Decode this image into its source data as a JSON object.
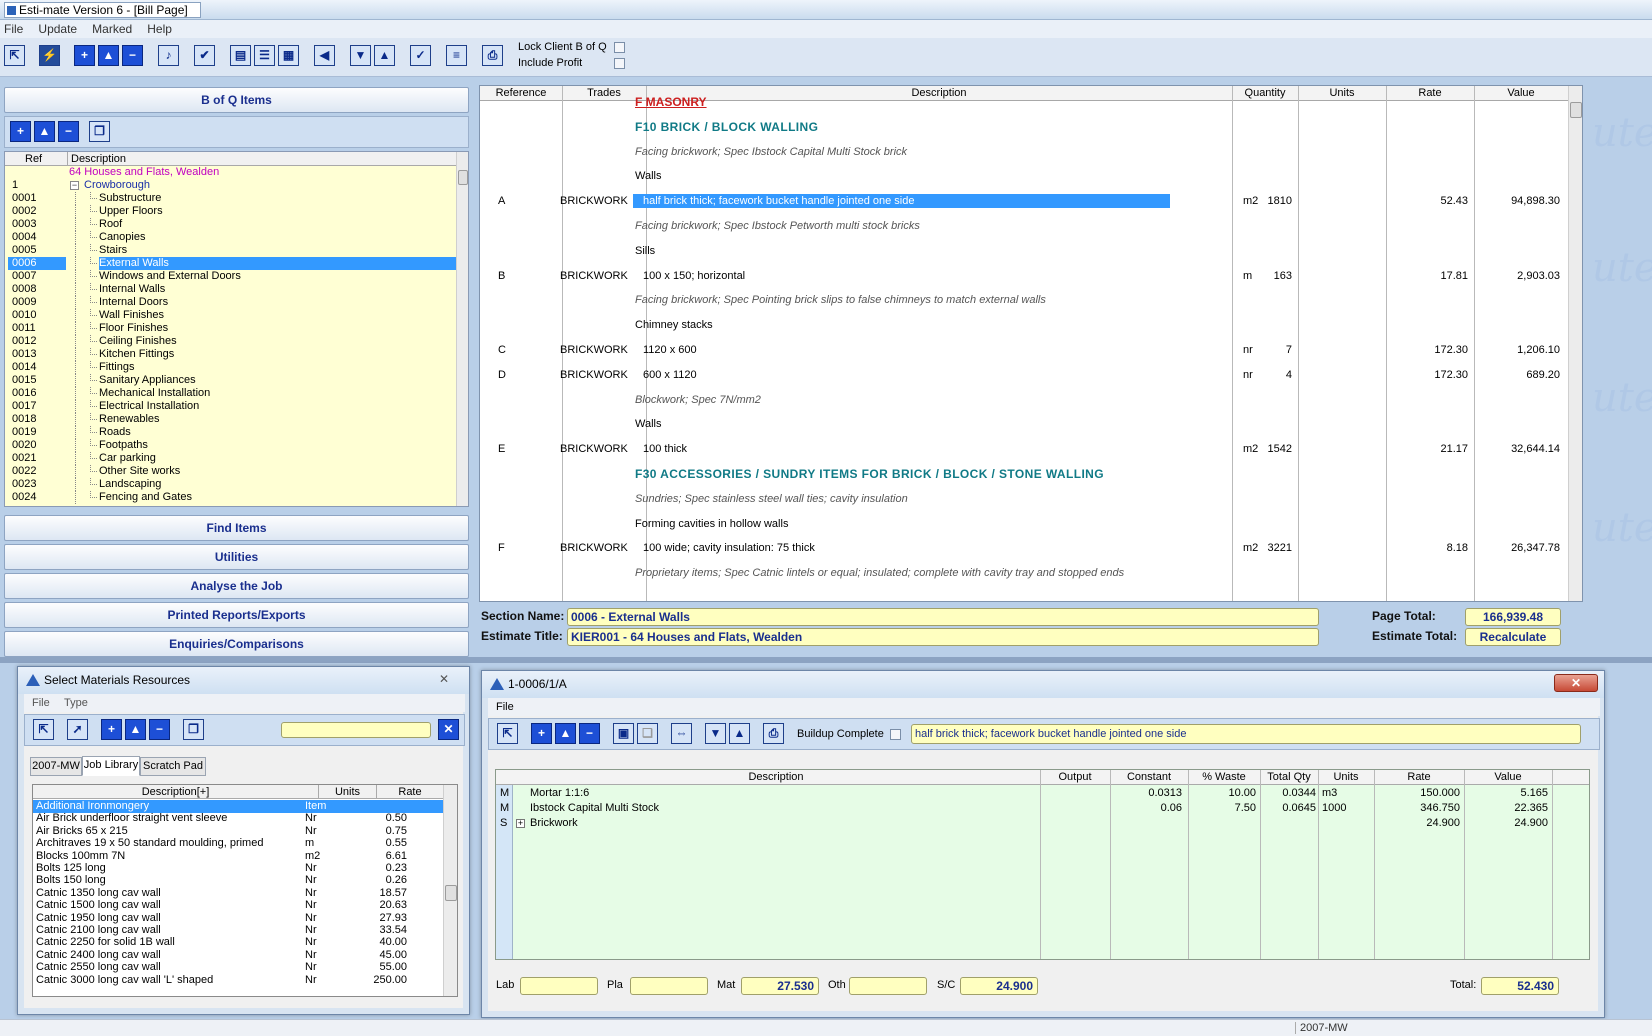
{
  "window": {
    "title": "Esti-mate Version 6 - [Bill Page]"
  },
  "menu": [
    "File",
    "Update",
    "Marked",
    "Help"
  ],
  "toolbar": {
    "lock_client_label": "Lock Client B of Q",
    "include_profit_label": "Include Profit"
  },
  "left_panel": {
    "boq_button": "B of Q Items",
    "tree_headers": {
      "ref": "Ref",
      "description": "Description"
    },
    "tree_rows": [
      {
        "ref": "",
        "desc": "64 Houses and Flats, Wealden",
        "level": 0,
        "color": "#c000c0"
      },
      {
        "ref": "1",
        "desc": "Crowborough",
        "level": 1,
        "color": "#1a2fa8"
      },
      {
        "ref": "0001",
        "desc": "Substructure",
        "level": 2
      },
      {
        "ref": "0002",
        "desc": "Upper Floors",
        "level": 2
      },
      {
        "ref": "0003",
        "desc": "Roof",
        "level": 2
      },
      {
        "ref": "0004",
        "desc": "Canopies",
        "level": 2
      },
      {
        "ref": "0005",
        "desc": "Stairs",
        "level": 2
      },
      {
        "ref": "0006",
        "desc": "External Walls",
        "level": 2,
        "selected": true
      },
      {
        "ref": "0007",
        "desc": "Windows and External Doors",
        "level": 2
      },
      {
        "ref": "0008",
        "desc": "Internal Walls",
        "level": 2
      },
      {
        "ref": "0009",
        "desc": "Internal Doors",
        "level": 2
      },
      {
        "ref": "0010",
        "desc": "Wall Finishes",
        "level": 2
      },
      {
        "ref": "0011",
        "desc": "Floor Finishes",
        "level": 2
      },
      {
        "ref": "0012",
        "desc": "Ceiling Finishes",
        "level": 2
      },
      {
        "ref": "0013",
        "desc": "Kitchen Fittings",
        "level": 2
      },
      {
        "ref": "0014",
        "desc": "Fittings",
        "level": 2
      },
      {
        "ref": "0015",
        "desc": "Sanitary Appliances",
        "level": 2
      },
      {
        "ref": "0016",
        "desc": "Mechanical Installation",
        "level": 2
      },
      {
        "ref": "0017",
        "desc": "Electrical Installation",
        "level": 2
      },
      {
        "ref": "0018",
        "desc": "Renewables",
        "level": 2
      },
      {
        "ref": "0019",
        "desc": "Roads",
        "level": 2
      },
      {
        "ref": "0020",
        "desc": "Footpaths",
        "level": 2
      },
      {
        "ref": "0021",
        "desc": "Car parking",
        "level": 2
      },
      {
        "ref": "0022",
        "desc": "Other Site works",
        "level": 2
      },
      {
        "ref": "0023",
        "desc": "Landscaping",
        "level": 2
      },
      {
        "ref": "0024",
        "desc": "Fencing and Gates",
        "level": 2
      }
    ],
    "buttons": [
      "Find Items",
      "Utilities",
      "Analyse the Job",
      "Printed Reports/Exports",
      "Enquiries/Comparisons"
    ]
  },
  "bill_grid": {
    "headers": [
      "Reference",
      "Trades",
      "Description",
      "Quantity",
      "Units",
      "Rate",
      "Value"
    ],
    "rows": [
      {
        "type": "h-red",
        "desc": "F MASONRY"
      },
      {
        "type": "h-teal",
        "desc": "F10 BRICK / BLOCK WALLING"
      },
      {
        "type": "ital",
        "desc": "Facing brickwork; Spec Ibstock Capital Multi Stock brick"
      },
      {
        "type": "plain",
        "desc": "Walls"
      },
      {
        "type": "item",
        "ref": "A",
        "trade": "BRICKWORK",
        "desc": "half brick thick; facework bucket handle jointed one side",
        "qty": "1810",
        "units": "m2",
        "rate": "52.43",
        "value": "94,898.30",
        "selected": true
      },
      {
        "type": "ital",
        "desc": "Facing brickwork; Spec Ibstock Petworth multi stock bricks"
      },
      {
        "type": "plain",
        "desc": "Sills"
      },
      {
        "type": "item",
        "ref": "B",
        "trade": "BRICKWORK",
        "desc": "100 x 150; horizontal",
        "qty": "163",
        "units": "m",
        "rate": "17.81",
        "value": "2,903.03"
      },
      {
        "type": "ital",
        "desc": "Facing brickwork; Spec Pointing brick slips to false chimneys to match external walls"
      },
      {
        "type": "plain",
        "desc": "Chimney stacks"
      },
      {
        "type": "item",
        "ref": "C",
        "trade": "BRICKWORK",
        "desc": "1120 x 600",
        "qty": "7",
        "units": "nr",
        "rate": "172.30",
        "value": "1,206.10"
      },
      {
        "type": "item",
        "ref": "D",
        "trade": "BRICKWORK",
        "desc": "600 x 1120",
        "qty": "4",
        "units": "nr",
        "rate": "172.30",
        "value": "689.20"
      },
      {
        "type": "ital",
        "desc": "Blockwork; Spec 7N/mm2"
      },
      {
        "type": "plain",
        "desc": "Walls"
      },
      {
        "type": "item",
        "ref": "E",
        "trade": "BRICKWORK",
        "desc": "100 thick",
        "qty": "1542",
        "units": "m2",
        "rate": "21.17",
        "value": "32,644.14"
      },
      {
        "type": "h-teal",
        "desc": "F30 ACCESSORIES / SUNDRY ITEMS FOR BRICK / BLOCK / STONE WALLING"
      },
      {
        "type": "ital",
        "desc": "Sundries; Spec stainless steel wall ties; cavity insulation"
      },
      {
        "type": "plain",
        "desc": "Forming cavities in hollow walls"
      },
      {
        "type": "item",
        "ref": "F",
        "trade": "BRICKWORK",
        "desc": "100 wide; cavity insulation: 75 thick",
        "qty": "3221",
        "units": "m2",
        "rate": "8.18",
        "value": "26,347.78"
      },
      {
        "type": "ital",
        "desc": "Proprietary items; Spec Catnic lintels or equal; insulated; complete with cavity tray and stopped ends"
      }
    ]
  },
  "summary": {
    "section_label": "Section Name:",
    "section_value": "0006 - External Walls",
    "estimate_label": "Estimate Title:",
    "estimate_value": "KIER001 - 64 Houses and Flats, Wealden",
    "page_total_label": "Page Total:",
    "page_total_value": "166,939.48",
    "estimate_total_label": "Estimate Total:",
    "recalc_label": "Recalculate"
  },
  "materials_window": {
    "title": "Select Materials Resources",
    "menu": [
      "File",
      "Type"
    ],
    "tabs": [
      "2007-MW",
      "Job Library",
      "Scratch Pad"
    ],
    "headers": {
      "description": "Description[+]",
      "units": "Units",
      "rate": "Rate"
    },
    "rows": [
      {
        "desc": "Additional Ironmongery",
        "units": "Item",
        "rate": "",
        "selected": true
      },
      {
        "desc": "Air Brick underfloor straight vent sleeve",
        "units": "Nr",
        "rate": "0.50"
      },
      {
        "desc": "Air Bricks 65 x 215",
        "units": "Nr",
        "rate": "0.75"
      },
      {
        "desc": "Architraves 19 x 50 standard moulding, primed",
        "units": "m",
        "rate": "0.55"
      },
      {
        "desc": "Blocks 100mm 7N",
        "units": "m2",
        "rate": "6.61"
      },
      {
        "desc": "Bolts 125 long",
        "units": "Nr",
        "rate": "0.23"
      },
      {
        "desc": "Bolts 150 long",
        "units": "Nr",
        "rate": "0.26"
      },
      {
        "desc": "Catnic 1350 long cav wall",
        "units": "Nr",
        "rate": "18.57"
      },
      {
        "desc": "Catnic 1500 long cav wall",
        "units": "Nr",
        "rate": "20.63"
      },
      {
        "desc": "Catnic 1950 long cav wall",
        "units": "Nr",
        "rate": "27.93"
      },
      {
        "desc": "Catnic 2100 long cav wall",
        "units": "Nr",
        "rate": "33.54"
      },
      {
        "desc": "Catnic 2250 for solid 1B wall",
        "units": "Nr",
        "rate": "40.00"
      },
      {
        "desc": "Catnic 2400 long cav wall",
        "units": "Nr",
        "rate": "45.00"
      },
      {
        "desc": "Catnic 2550 long cav wall",
        "units": "Nr",
        "rate": "55.00"
      },
      {
        "desc": "Catnic 3000 long cav wall 'L' shaped",
        "units": "Nr",
        "rate": "250.00"
      }
    ]
  },
  "buildup_window": {
    "title": "1-0006/1/A",
    "menu": [
      "File"
    ],
    "buildup_complete_label": "Buildup Complete",
    "item_desc": "half brick thick; facework bucket handle jointed one side",
    "headers": [
      "Description",
      "Output",
      "Constant",
      "% Waste",
      "Total Qty",
      "Units",
      "Rate",
      "Value"
    ],
    "rows": [
      {
        "code": "M",
        "desc": "Mortar 1:1:6",
        "output": "",
        "constant": "0.0313",
        "waste": "10.00",
        "total_qty": "0.0344",
        "units": "m3",
        "rate": "150.000",
        "value": "5.165"
      },
      {
        "code": "M",
        "desc": "Ibstock Capital Multi Stock",
        "output": "",
        "constant": "0.06",
        "waste": "7.50",
        "total_qty": "0.0645",
        "units": "1000",
        "rate": "346.750",
        "value": "22.365"
      },
      {
        "code": "S",
        "desc": "Brickwork",
        "output": "",
        "constant": "",
        "waste": "",
        "total_qty": "",
        "units": "",
        "rate": "24.900",
        "value": "24.900",
        "expander": "+"
      }
    ],
    "totals": {
      "lab_label": "Lab",
      "lab": "",
      "pla_label": "Pla",
      "pla": "",
      "mat_label": "Mat",
      "mat": "27.530",
      "oth_label": "Oth",
      "oth": "",
      "sc_label": "S/C",
      "sc": "24.900",
      "total_label": "Total:",
      "total": "52.430"
    }
  },
  "statusbar": {
    "library": "2007-MW"
  },
  "colors": {
    "accent": "#1d4fd6",
    "selection": "#3399ff",
    "field_yellow": "#ffffc0",
    "tree_bg": "#ffffd4",
    "buildup_bg": "#e6fce6"
  }
}
